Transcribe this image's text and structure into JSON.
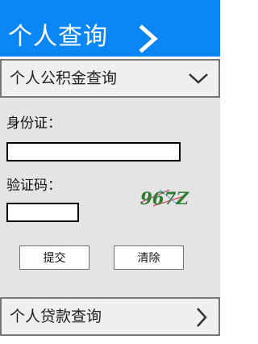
{
  "header": {
    "title": "个人查询"
  },
  "fund_section": {
    "label": "个人公积金查询"
  },
  "form": {
    "id_label": "身份证：",
    "id_value": "",
    "code_label": "验证码：",
    "code_value": "",
    "captcha_text": "967Z",
    "submit_label": "提交",
    "clear_label": "清除"
  },
  "loan_section": {
    "label": "个人贷款查询"
  },
  "colors": {
    "header_bg": "#0a86f5",
    "panel_bg": "#efefef",
    "form_bg": "#e4e4e4",
    "border": "#777777"
  },
  "icons": {
    "header": "chevron-right-icon",
    "fund_section": "chevron-down-icon",
    "loan_section": "chevron-right-icon"
  }
}
